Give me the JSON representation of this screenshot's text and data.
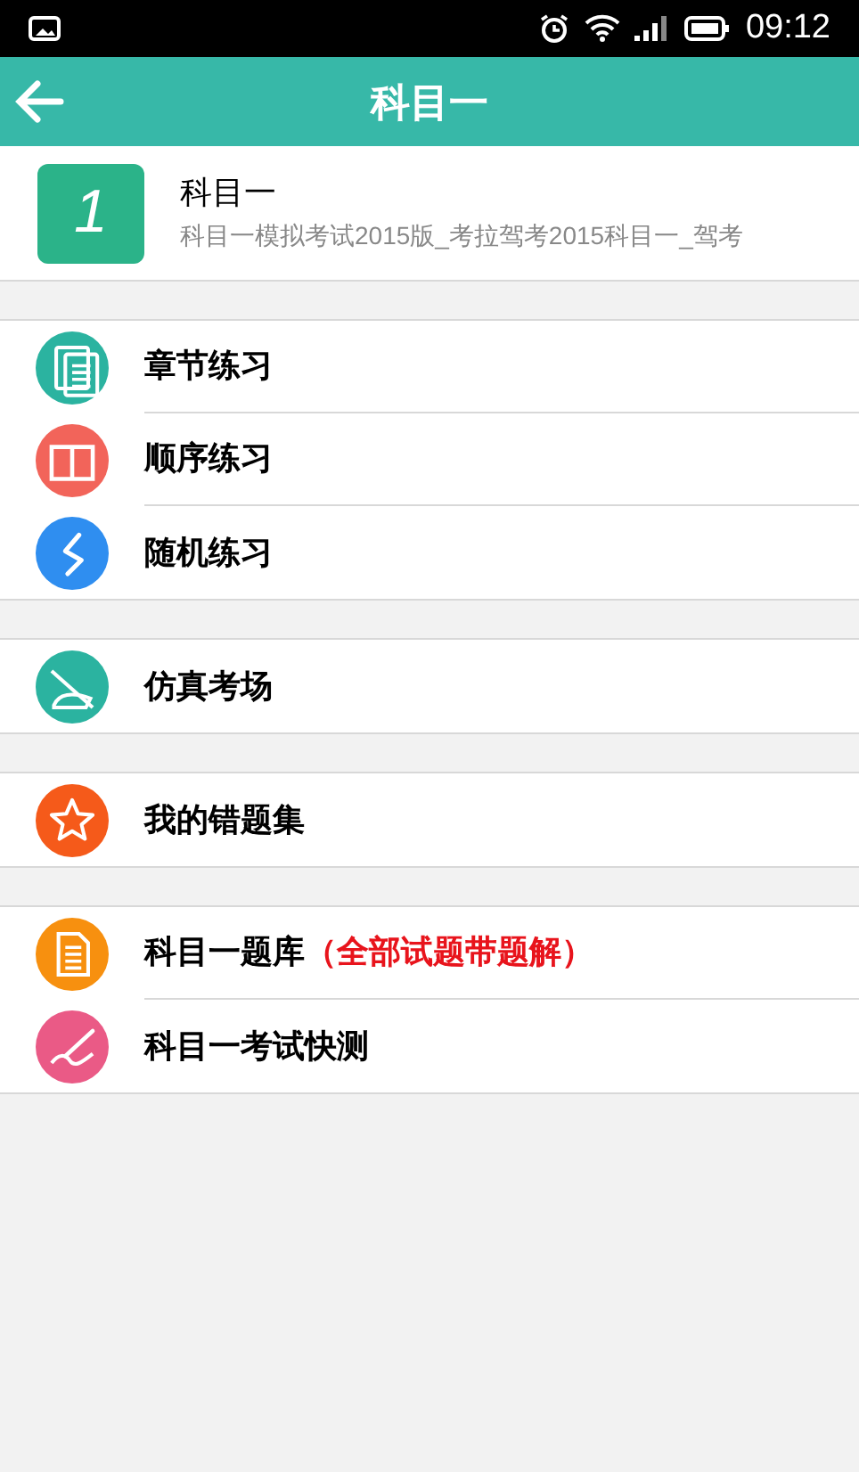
{
  "status_bar": {
    "time": "09:12"
  },
  "header": {
    "title": "科目一"
  },
  "subject": {
    "badge": "1",
    "title": "科目一",
    "subtitle": "科目一模拟考试2015版_考拉驾考2015科目一_驾考"
  },
  "groups": [
    {
      "items": [
        {
          "label": "章节练习",
          "kind": "pages",
          "color": "#2bb3a0"
        },
        {
          "label": "顺序练习",
          "kind": "book",
          "color": "#f2645a"
        },
        {
          "label": "随机练习",
          "kind": "random",
          "color": "#2f8ef0"
        }
      ]
    },
    {
      "items": [
        {
          "label": "仿真考场",
          "kind": "exam",
          "color": "#2bb3a0"
        }
      ]
    },
    {
      "items": [
        {
          "label": "我的错题集",
          "kind": "star",
          "color": "#f55a1a"
        }
      ]
    },
    {
      "items": [
        {
          "label": "科目一题库",
          "note": "（全部试题带题解）",
          "kind": "document",
          "color": "#f7900f"
        },
        {
          "label": "科目一考试快测",
          "kind": "write",
          "color": "#ea5a86"
        }
      ]
    }
  ]
}
